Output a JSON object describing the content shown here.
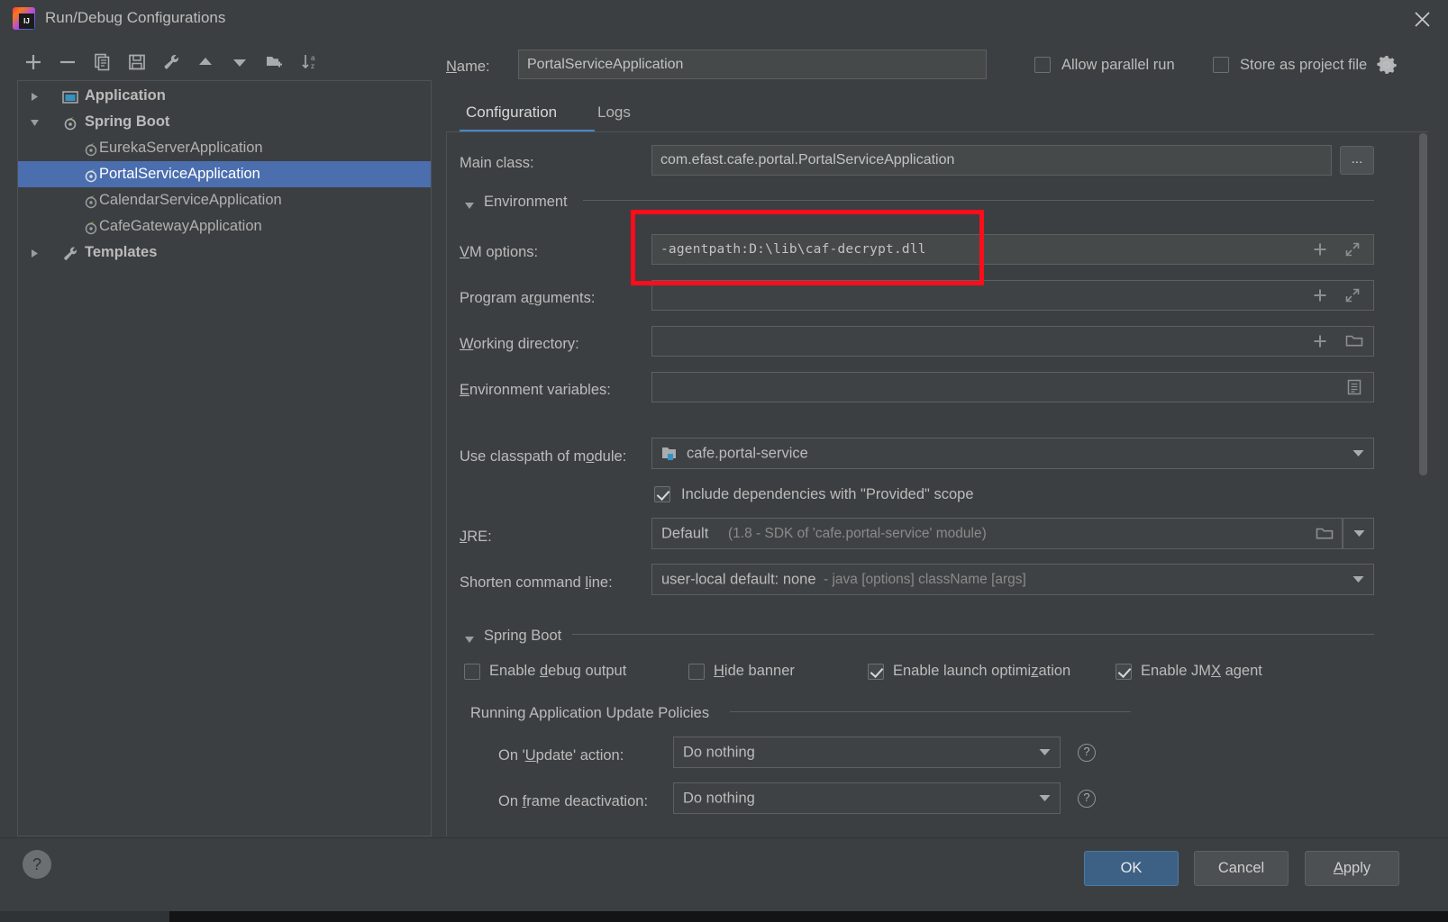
{
  "window": {
    "title": "Run/Debug Configurations",
    "logo_icon": "intellij-idea-logo",
    "close_icon": "close-icon"
  },
  "toolbar": {
    "items": [
      {
        "icon": "plus-icon",
        "name": "add-configuration-button"
      },
      {
        "icon": "minus-icon",
        "name": "remove-configuration-button"
      },
      {
        "icon": "copy-icon",
        "name": "copy-configuration-button"
      },
      {
        "icon": "save-icon",
        "name": "save-configuration-button"
      },
      {
        "icon": "wrench-icon",
        "name": "edit-templates-button"
      },
      {
        "icon": "arrow-up-icon",
        "name": "move-up-button"
      },
      {
        "icon": "arrow-down-icon",
        "name": "move-down-button"
      },
      {
        "icon": "new-folder-icon",
        "name": "create-folder-button"
      },
      {
        "icon": "sort-alphabetical-icon",
        "name": "sort-configurations-button"
      }
    ]
  },
  "tree": {
    "nodes": [
      {
        "label": "Application",
        "kind": "group",
        "expanded": false,
        "icon": "application-icon",
        "selected": false
      },
      {
        "label": "Spring Boot",
        "kind": "group",
        "expanded": true,
        "icon": "spring-boot-icon",
        "selected": false
      },
      {
        "label": "EurekaServerApplication",
        "kind": "child",
        "icon": "spring-boot-icon",
        "selected": false
      },
      {
        "label": "PortalServiceApplication",
        "kind": "child",
        "icon": "spring-boot-icon",
        "selected": true
      },
      {
        "label": "CalendarServiceApplication",
        "kind": "child",
        "icon": "spring-boot-icon",
        "selected": false
      },
      {
        "label": "CafeGatewayApplication",
        "kind": "child",
        "icon": "spring-boot-icon",
        "selected": false
      },
      {
        "label": "Templates",
        "kind": "group",
        "expanded": false,
        "icon": "wrench-icon",
        "selected": false
      }
    ]
  },
  "header": {
    "name_label": "Name:",
    "name_value": "PortalServiceApplication",
    "allow_parallel_run": {
      "label": "Allow parallel run",
      "checked": false
    },
    "store_as_project_file": {
      "label": "Store as project file",
      "checked": false
    },
    "gear_icon": "gear-icon"
  },
  "tabs": [
    {
      "label": "Configuration",
      "active": true
    },
    {
      "label": "Logs",
      "active": false
    }
  ],
  "form": {
    "main_class": {
      "label": "Main class:",
      "value": "com.efast.cafe.portal.PortalServiceApplication",
      "browse_label": "..."
    },
    "environment_section": "Environment",
    "vm_options": {
      "label": "VM options:",
      "value": "-agentpath:D:\\lib\\caf-decrypt.dll",
      "highlighted": true
    },
    "program_arguments": {
      "label": "Program arguments:",
      "value": ""
    },
    "working_directory": {
      "label": "Working directory:",
      "value": ""
    },
    "environment_variables": {
      "label": "Environment variables:",
      "value": ""
    },
    "use_classpath_of_module": {
      "label": "Use classpath of module:",
      "value": "cafe.portal-service",
      "icon": "module-icon"
    },
    "include_provided_scope": {
      "label": "Include dependencies with \"Provided\" scope",
      "checked": true
    },
    "jre": {
      "label": "JRE:",
      "value": "Default",
      "hint": "(1.8 - SDK of 'cafe.portal-service' module)"
    },
    "shorten_command_line": {
      "label": "Shorten command line:",
      "value": "user-local default: none",
      "hint": "- java [options] className [args]"
    },
    "spring_boot_section": "Spring Boot",
    "spring_boot_checks": [
      {
        "label": "Enable debug output",
        "checked": false,
        "underline_index": 7
      },
      {
        "label": "Hide banner",
        "checked": false,
        "underline_index": 0
      },
      {
        "label": "Enable launch optimization",
        "checked": true,
        "underline_index": 20
      },
      {
        "label": "Enable JMX agent",
        "checked": true,
        "underline_index": 10
      }
    ],
    "update_policies_section": "Running Application Update Policies",
    "on_update_action": {
      "label": "On 'Update' action:",
      "value": "Do nothing"
    },
    "on_frame_deactivation": {
      "label": "On frame deactivation:",
      "value": "Do nothing"
    },
    "help_icon": "question-mark-icon"
  },
  "footer": {
    "help_label": "?",
    "ok": "OK",
    "cancel": "Cancel",
    "apply": "Apply"
  },
  "colors": {
    "background": "#3c3f41",
    "selection": "#4b6eaf",
    "accent": "#4a88c7",
    "annotation": "#fc0d1b",
    "field_bg": "#45494a",
    "primary_button": "#3d6185"
  }
}
